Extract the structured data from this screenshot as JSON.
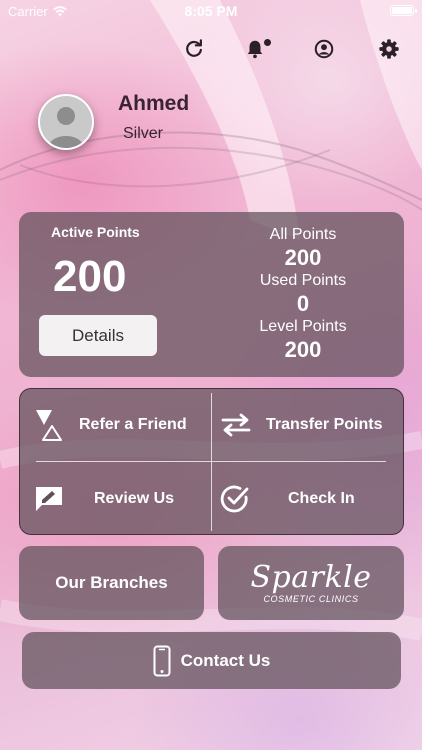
{
  "status_bar": {
    "carrier": "Carrier",
    "time": "8:05 PM"
  },
  "toolbar": {
    "icons": [
      "refresh-icon",
      "bell-icon",
      "profile-icon",
      "gear-icon"
    ],
    "notification_dot": true
  },
  "profile": {
    "name": "Ahmed",
    "tier": "Silver"
  },
  "points": {
    "active_label": "Active Points",
    "active_value": "200",
    "details_label": "Details",
    "all_label": "All Points",
    "all_value": "200",
    "used_label": "Used Points",
    "used_value": "0",
    "level_label": "Level Points",
    "level_value": "200"
  },
  "actions": {
    "refer": "Refer a Friend",
    "transfer": "Transfer Points",
    "review": "Review Us",
    "checkin": "Check In"
  },
  "branches_label": "Our Branches",
  "logo": {
    "script": "Sparkle",
    "subtitle": "COSMETIC CLINICS"
  },
  "contact_label": "Contact Us",
  "colors": {
    "card": "#60505a",
    "text": "#ffffff",
    "name": "#3a2433"
  }
}
